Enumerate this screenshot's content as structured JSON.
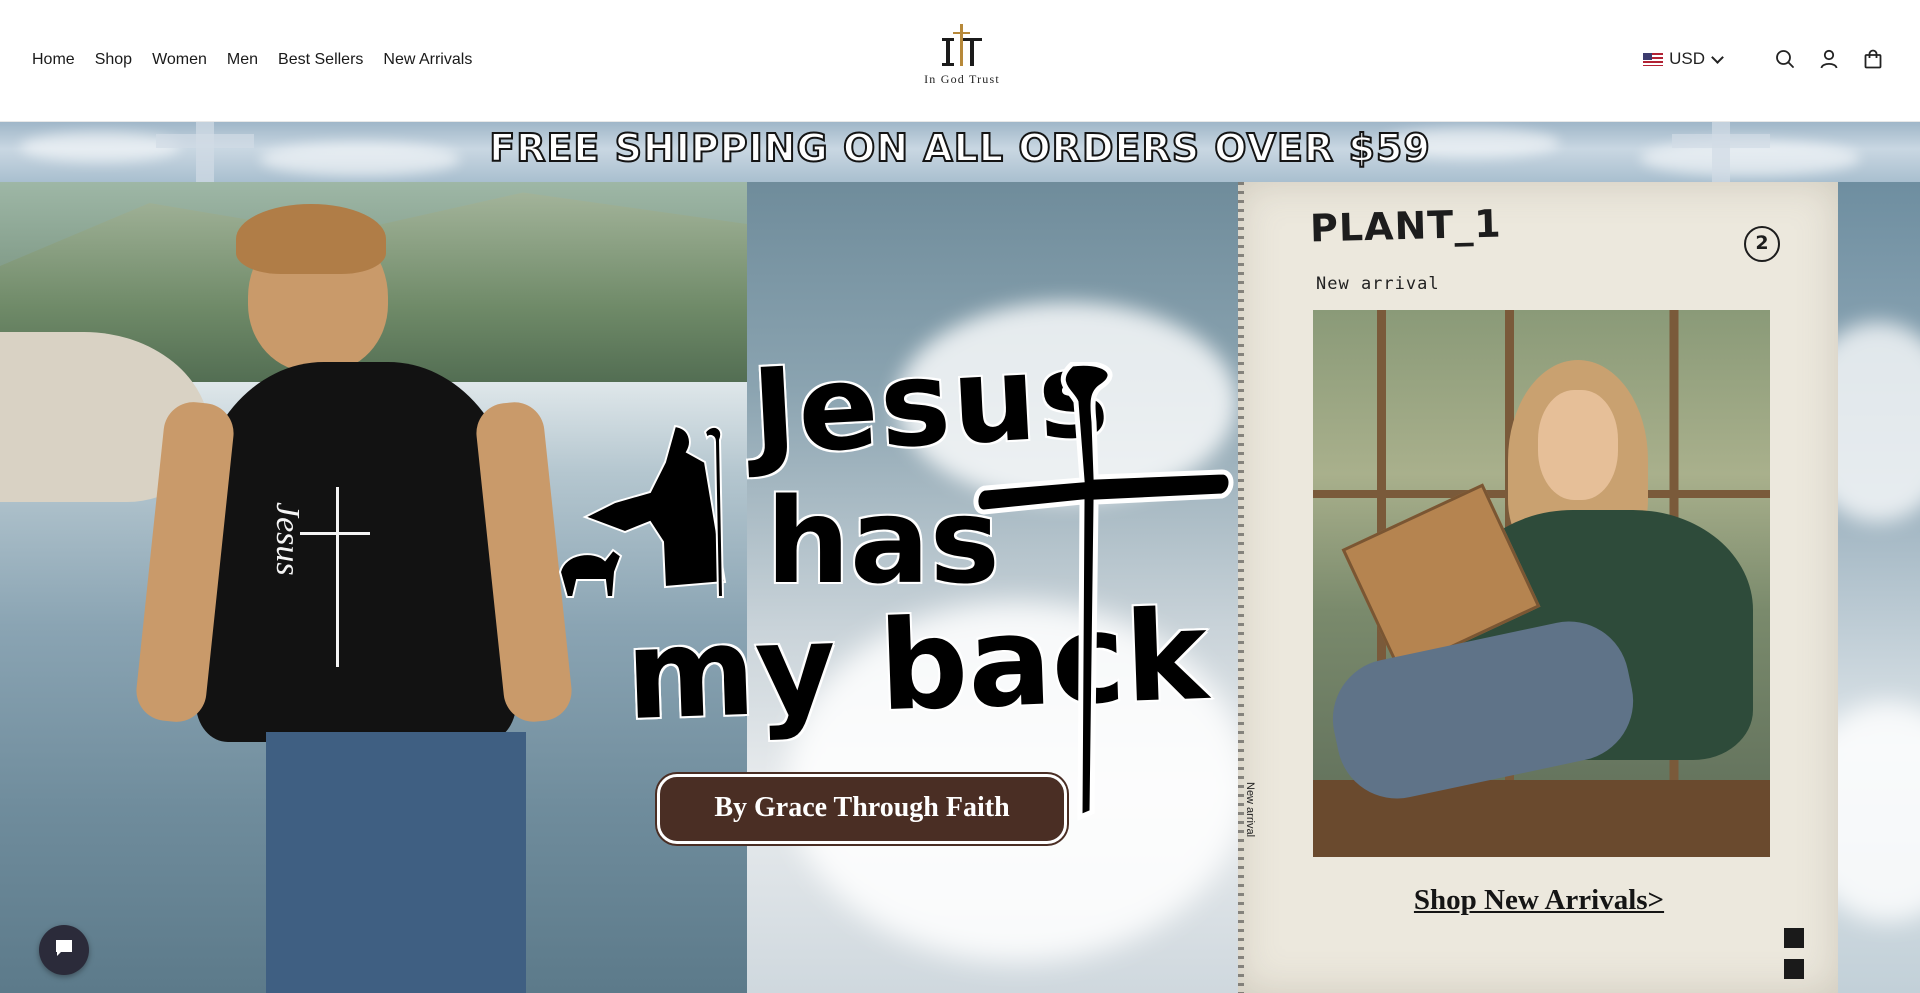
{
  "nav": {
    "items": [
      "Home",
      "Shop",
      "Women",
      "Men",
      "Best Sellers",
      "New Arrivals"
    ]
  },
  "logo": {
    "brand": "In God Trust"
  },
  "header": {
    "currency": "USD",
    "icons": [
      "search-icon",
      "account-icon",
      "cart-icon"
    ]
  },
  "promo": {
    "text": "FREE SHIPPING ON ALL ORDERS OVER $59"
  },
  "hero": {
    "headline_line1": "Jesus",
    "headline_line2": "has",
    "headline_line3": "my back",
    "tagline": "By Grace Through Faith",
    "shirt_text": "Jesus"
  },
  "feature": {
    "title": "PLANT_1",
    "number": "2",
    "label": "New arrival",
    "side_label": "New arrival",
    "cta": "Shop New Arrivals>"
  },
  "colors": {
    "pill_bg": "#4a2e24",
    "paper": "#ece8dd",
    "chat": "#2b2b3a"
  }
}
